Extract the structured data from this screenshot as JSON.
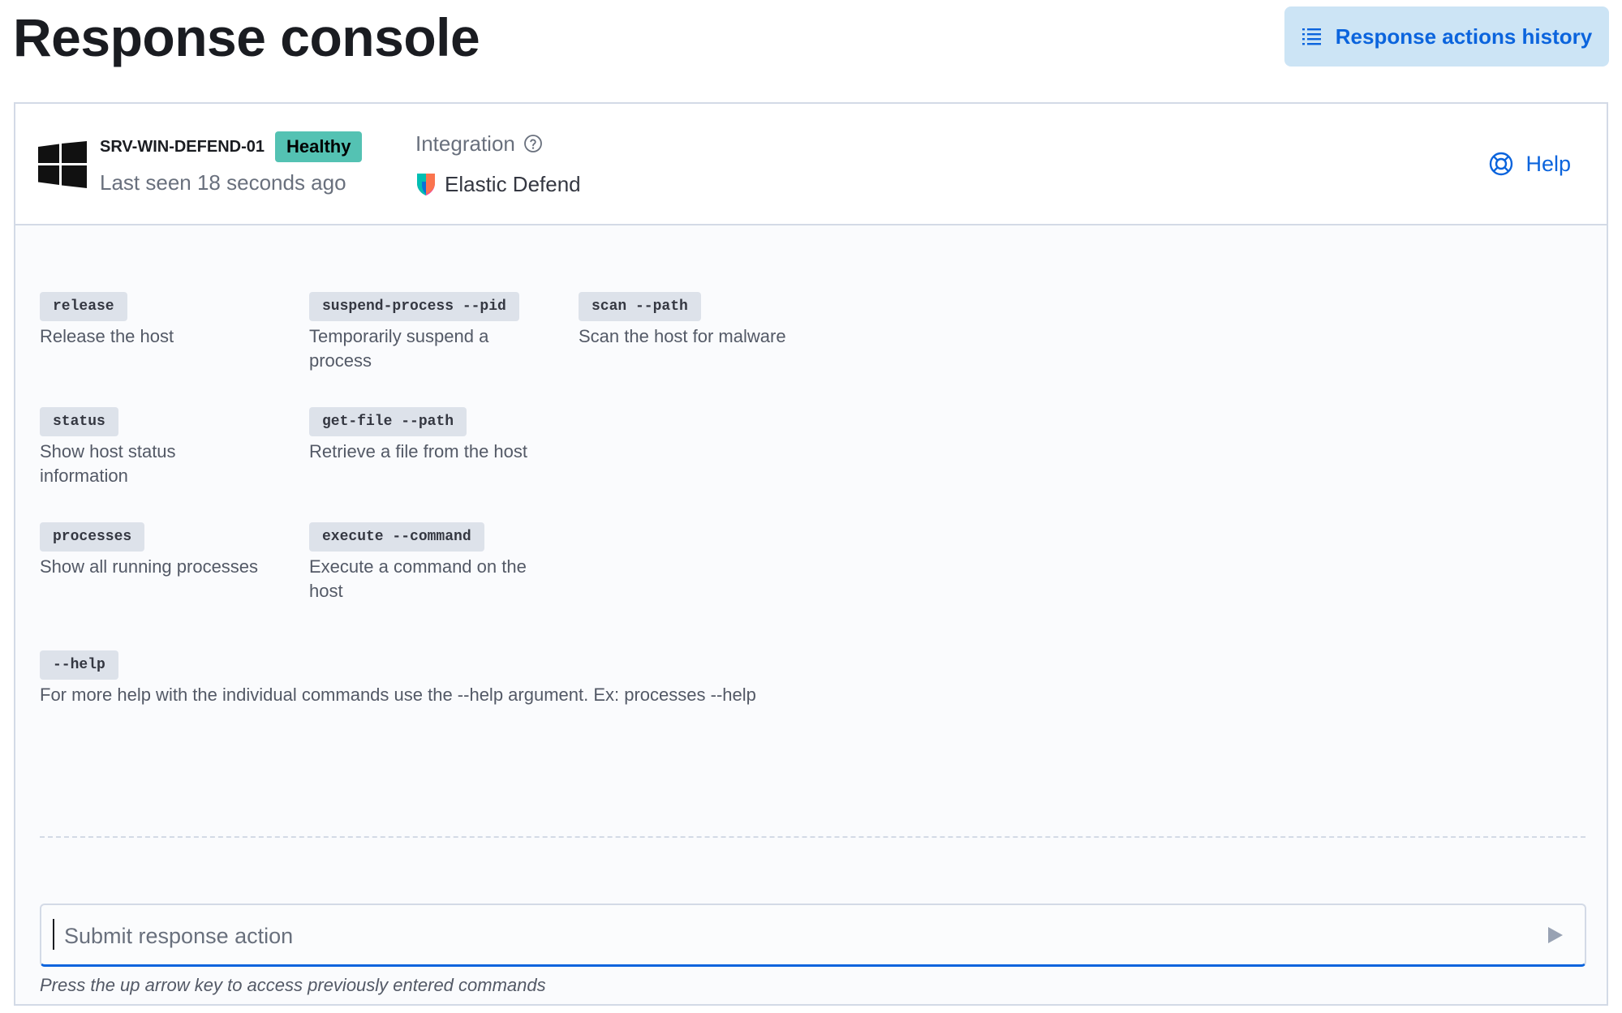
{
  "page": {
    "title": "Response console",
    "history_button": "Response actions history"
  },
  "header": {
    "host_name": "SRV-WIN-DEFEND-01",
    "health": "Healthy",
    "last_seen": "Last seen 18 seconds ago",
    "integration_label": "Integration",
    "integration_name": "Elastic Defend",
    "help_label": "Help"
  },
  "commands": [
    {
      "name": "release",
      "desc": "Release the host"
    },
    {
      "name": "suspend-process --pid",
      "desc": "Temporarily suspend a process"
    },
    {
      "name": "scan --path",
      "desc": "Scan the host for malware"
    },
    {
      "name": "status",
      "desc": "Show host status information"
    },
    {
      "name": "get-file --path",
      "desc": "Retrieve a file from the host"
    },
    {
      "name": "processes",
      "desc": "Show all running processes"
    },
    {
      "name": "execute --command",
      "desc": "Execute a command on the host"
    }
  ],
  "help_command": {
    "name": "--help",
    "desc": "For more help with the individual commands use the --help argument. Ex: processes --help"
  },
  "input": {
    "placeholder": "Submit response action",
    "hint": "Press the up arrow key to access previously entered commands"
  },
  "colors": {
    "accent": "#0b64dd",
    "healthy": "#54c2b3",
    "button_bg": "#cce4f5"
  }
}
